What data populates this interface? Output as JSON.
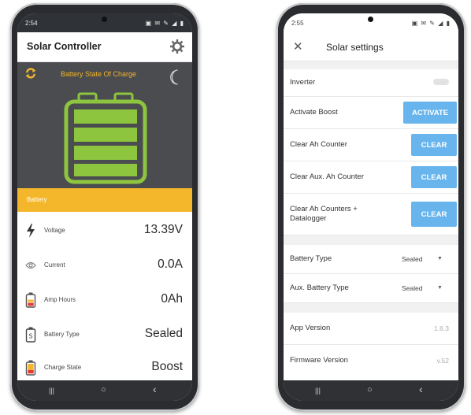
{
  "left_phone": {
    "status_time": "2:54",
    "status_icons": "▣ ✉ ✎ ◢ ▮",
    "app_title": "Solar Controller",
    "hero_label": "Battery State Of Charge",
    "battery_level_fraction": 1.0,
    "section_title": "Battery",
    "rows": [
      {
        "label": "Voltage",
        "value": "13.39V",
        "icon": "lightning-icon"
      },
      {
        "label": "Current",
        "value": "0.0A",
        "icon": "current-icon"
      },
      {
        "label": "Amp Hours",
        "value": "0Ah",
        "icon": "battery-low-icon"
      },
      {
        "label": "Battery Type",
        "value": "Sealed",
        "icon": "battery-type-icon"
      },
      {
        "label": "Charge State",
        "value": "Boost",
        "icon": "charge-state-icon"
      }
    ],
    "nav": {
      "recents": "|||",
      "home": "○",
      "back": "‹"
    }
  },
  "right_phone": {
    "status_time": "2:55",
    "status_icons": "▣ ✉ ✎ ◢ ▮",
    "close_glyph": "✕",
    "app_title": "Solar settings",
    "inverter_label": "Inverter",
    "activate_boost_label": "Activate Boost",
    "activate_button": "ACTIVATE",
    "clear_ah_label": "Clear Ah Counter",
    "clear_aux_ah_label": "Clear Aux. Ah Counter",
    "clear_all_label_line1": "Clear Ah Counters +",
    "clear_all_label_line2": "Datalogger",
    "clear_button": "CLEAR",
    "battery_type_label": "Battery Type",
    "battery_type_value": "Sealed",
    "aux_battery_type_label": "Aux. Battery Type",
    "aux_battery_type_value": "Sealed",
    "app_version_label": "App Version",
    "app_version_value": "1.6.3",
    "firmware_version_label": "Firmware Version",
    "firmware_version_value": "v.52",
    "nav": {
      "recents": "|||",
      "home": "○",
      "back": "‹"
    }
  },
  "colors": {
    "accent_yellow": "#f4b72c",
    "battery_green": "#8dc53e",
    "hero_bg": "#4a4c50",
    "button_blue": "#68b5ed"
  }
}
